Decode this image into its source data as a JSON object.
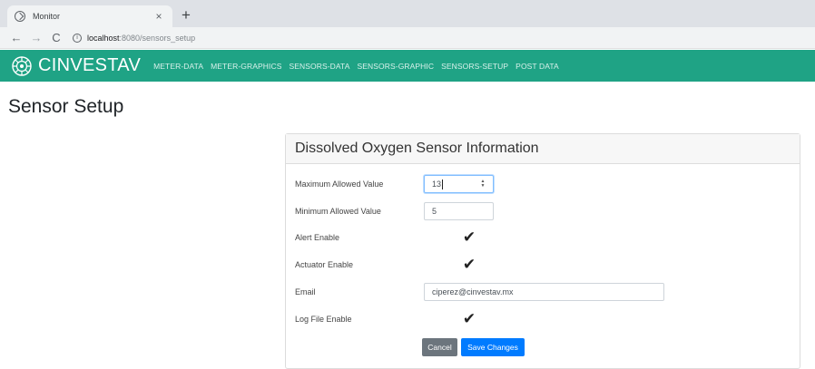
{
  "browser": {
    "tab_title": "Monitor",
    "tab_close": "×",
    "new_tab": "+",
    "back": "←",
    "forward": "→",
    "reload": "C",
    "url_host": "localhost",
    "url_path": ":8080/sensors_setup"
  },
  "navbar": {
    "brand": "CINVESTAV",
    "links": [
      "METER-DATA",
      "METER-GRAPHICS",
      "SENSORS-DATA",
      "SENSORS-GRAPHIC",
      "SENSORS-SETUP",
      "POST DATA"
    ],
    "color": "#1fa385"
  },
  "page": {
    "title": "Sensor Setup"
  },
  "card": {
    "title": "Dissolved Oxygen Sensor Information",
    "fields": {
      "max_label": "Maximum Allowed Value",
      "max_value": "13",
      "min_label": "Minimum Allowed Value",
      "min_value": "5",
      "alert_label": "Alert Enable",
      "alert_checked": true,
      "actuator_label": "Actuator Enable",
      "actuator_checked": true,
      "email_label": "Email",
      "email_value": "ciperez@cinvestav.mx",
      "log_label": "Log File Enable",
      "log_checked": true
    },
    "cancel_label": "Cancel",
    "save_label": "Save Changes"
  }
}
